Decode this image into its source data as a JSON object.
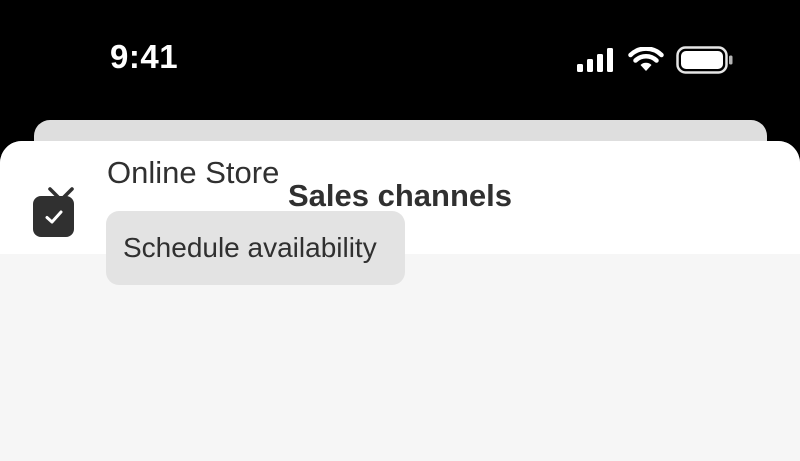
{
  "status_bar": {
    "time": "9:41",
    "icons": [
      "cellular-signal-icon",
      "wifi-icon",
      "battery-icon"
    ]
  },
  "sheet": {
    "title": "Sales channels",
    "close_icon": "close-icon"
  },
  "channels": [
    {
      "label": "Online Store",
      "checked": true,
      "schedule_label": "Schedule availability"
    }
  ],
  "colors": {
    "status_bar_bg": "#000000",
    "sheet_header_bg": "#ffffff",
    "sheet_body_bg": "#f6f6f6",
    "text": "#303030",
    "checkbox_fill": "#303030",
    "secondary_button_bg": "#e3e3e3"
  }
}
